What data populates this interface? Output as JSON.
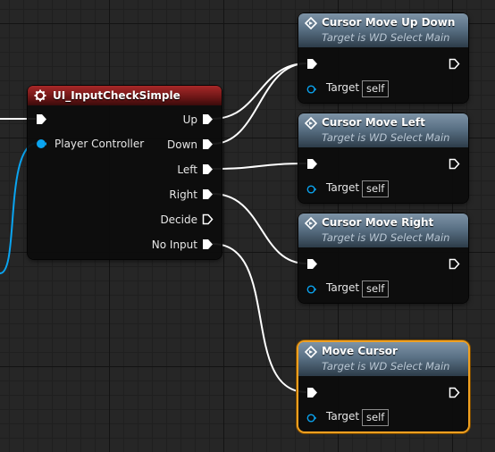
{
  "graph": {
    "nodes": {
      "input_check": {
        "title": "UI_InputCheckSimple",
        "inputs": [
          "Player Controller"
        ],
        "outputs": [
          "Up",
          "Down",
          "Left",
          "Right",
          "Decide",
          "No Input"
        ]
      },
      "cursor_up_down": {
        "title": "Cursor Move Up Down",
        "subtitle": "Target is WD Select Main",
        "target_label": "Target",
        "target_value": "self"
      },
      "cursor_left": {
        "title": "Cursor Move Left",
        "subtitle": "Target is WD Select Main",
        "target_label": "Target",
        "target_value": "self"
      },
      "cursor_right": {
        "title": "Cursor Move Right",
        "subtitle": "Target is WD Select Main",
        "target_label": "Target",
        "target_value": "self"
      },
      "move_cursor": {
        "title": "Move Cursor",
        "subtitle": "Target is WD Select Main",
        "target_label": "Target",
        "target_value": "self",
        "selected": true
      }
    }
  },
  "colors": {
    "exec_pin": "#ffffff",
    "object_pin": "#0aa4f0",
    "pure_header": "#5a7185",
    "event_header": "#8a1f1f",
    "selection": "#f0a020"
  },
  "icons": {
    "function_icon": "diamond-function-icon",
    "event_icon": "gear-icon"
  }
}
